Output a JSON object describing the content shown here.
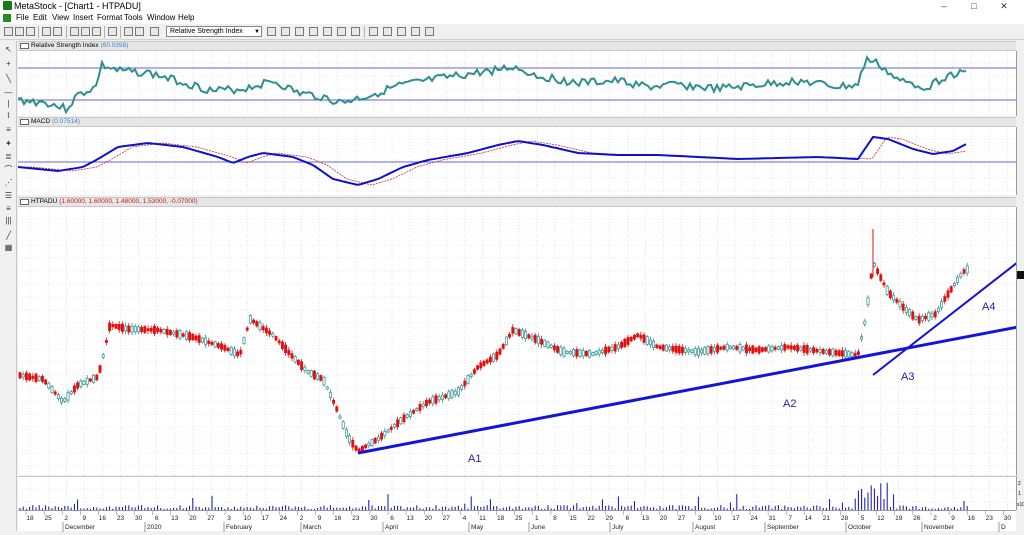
{
  "window": {
    "title": "MetaStock - [Chart1 - HTPADU]",
    "minimize": "–",
    "maximize": "□",
    "close": "✕"
  },
  "menu": [
    "File",
    "Edit",
    "View",
    "Insert",
    "Format",
    "Tools",
    "Window",
    "Help"
  ],
  "toolbar": {
    "indicator_select": "Relative Strength Index",
    "icons": [
      "new-icon",
      "open-icon",
      "save-icon",
      "print-icon",
      "print-preview-icon",
      "cut-icon",
      "copy-icon",
      "paste-icon",
      "undo-icon",
      "crosshair-icon",
      "zoom-icon",
      "indicator-icon",
      "expert-icon",
      "explorer-icon",
      "system-tester-icon",
      "binoculars-icon",
      "smart-chart-icon",
      "layout-1-icon",
      "layout-2-icon",
      "layout-3-icon",
      "layout-4-icon",
      "layout-5-icon"
    ]
  },
  "left_tools": [
    "pointer-icon",
    "crosshair-icon",
    "trendline-icon",
    "horizontal-line-icon",
    "vertical-line-icon",
    "cycle-icon",
    "fibonacci-icon",
    "gann-icon",
    "text-icon",
    "channel-icon",
    "speed-line-icon",
    "arc-icon",
    "quadrant-icon",
    "regression-icon",
    "pen-icon",
    "fill-icon"
  ],
  "panes": {
    "rsi": {
      "name": "Relative Strength Index",
      "value": "(60.0398)"
    },
    "macd": {
      "name": "MACD",
      "value": "(0.07514)"
    },
    "price": {
      "name": "HTPADU",
      "ohlc": "(1.60000, 1.60000, 1.48000, 1.53000, -0.07000)"
    }
  },
  "annotations": [
    {
      "label": "A1"
    },
    {
      "label": "A2"
    },
    {
      "label": "A3"
    },
    {
      "label": "A4"
    }
  ],
  "volume_scale": [
    "2",
    "1",
    "x10"
  ],
  "x_axis": {
    "days": [
      "18",
      "25",
      "2",
      "9",
      "16",
      "23",
      "30",
      "6",
      "13",
      "20",
      "27",
      "3",
      "10",
      "17",
      "24",
      "2",
      "9",
      "16",
      "23",
      "30",
      "6",
      "13",
      "20",
      "27",
      "4",
      "11",
      "18",
      "25",
      "1",
      "8",
      "15",
      "22",
      "29",
      "6",
      "13",
      "20",
      "27",
      "3",
      "10",
      "17",
      "24",
      "31",
      "7",
      "14",
      "21",
      "28",
      "5",
      "12",
      "19",
      "26",
      "2",
      "9",
      "16",
      "23",
      "30"
    ],
    "months": [
      "December",
      "2020",
      "February",
      "March",
      "April",
      "May",
      "June",
      "July",
      "August",
      "September",
      "October",
      "November",
      "D"
    ]
  },
  "colors": {
    "rsi_line": "#2f8f8f",
    "macd_line": "#1010c8",
    "macd_signal": "#c03030",
    "up_candle": "#2a9090",
    "down_candle": "#e01010",
    "trendline": "#1414d8",
    "annotation": "#2020b0",
    "volume": "#1010b0",
    "ref_line": "#3030c0"
  }
}
